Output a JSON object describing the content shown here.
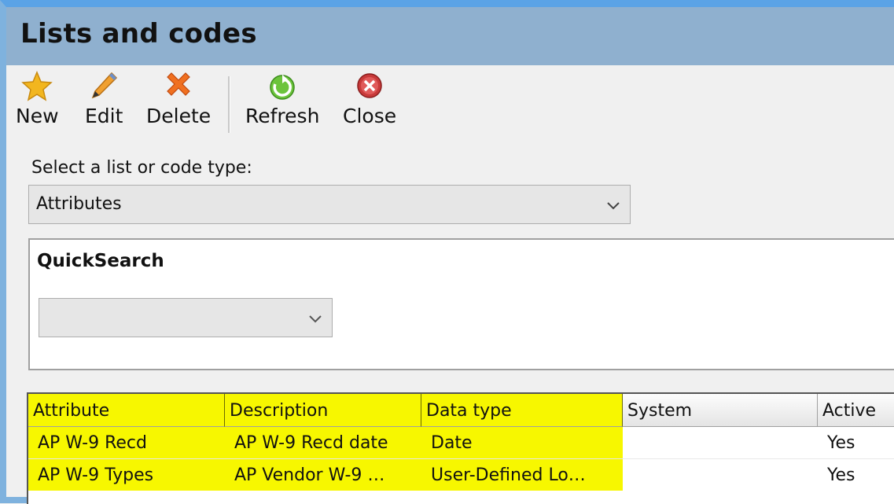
{
  "window": {
    "title": "Lists and codes"
  },
  "toolbar": {
    "new_label": "New",
    "edit_label": "Edit",
    "delete_label": "Delete",
    "refresh_label": "Refresh",
    "close_label": "Close",
    "icons": [
      "star-icon",
      "pencil-icon",
      "x-icon",
      "refresh-icon",
      "close-circle-icon"
    ]
  },
  "selector": {
    "label": "Select a list or code type:",
    "value": "Attributes"
  },
  "quicksearch": {
    "title": "QuickSearch",
    "value": ""
  },
  "grid": {
    "columns": [
      "Attribute",
      "Description",
      "Data type",
      "System",
      "Active"
    ],
    "rows": [
      {
        "attribute": "AP W-9 Recd",
        "description": "AP W-9 Recd date",
        "data_type": "Date",
        "system": "",
        "active": "Yes"
      },
      {
        "attribute": "AP W-9 Types",
        "description": "AP Vendor W-9 …",
        "data_type": "User-Defined Lo…",
        "system": "",
        "active": "Yes"
      }
    ],
    "highlight_color": "#f7f700"
  }
}
